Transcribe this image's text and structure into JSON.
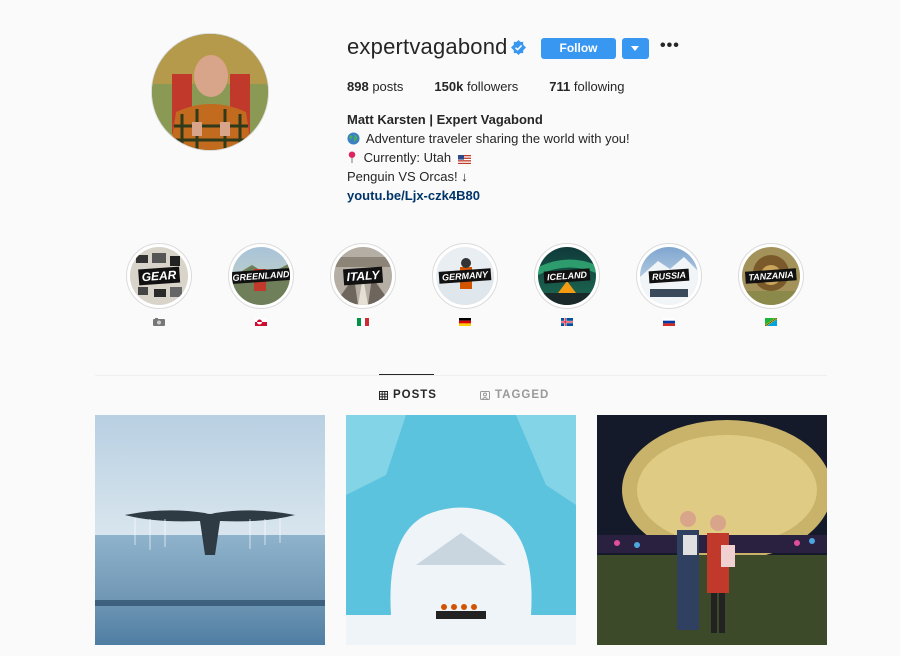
{
  "profile": {
    "username": "expertvagabond",
    "follow_label": "Follow",
    "more_label": "•••",
    "stats": {
      "posts_count": "898",
      "posts_label": "posts",
      "followers_count": "150k",
      "followers_label": "followers",
      "following_count": "711",
      "following_label": "following"
    },
    "bio": {
      "full_name": "Matt Karsten | Expert Vagabond",
      "line1": "Adventure traveler sharing the world with you!",
      "line2": "Currently: Utah",
      "line3": "Penguin VS Orcas! ↓",
      "link": "youtu.be/Ljx-czk4B80"
    }
  },
  "highlights": [
    {
      "label": "GEAR",
      "flag_icon": "camera-icon"
    },
    {
      "label": "GREENLAND",
      "flag_icon": "greenland-flag-icon"
    },
    {
      "label": "ITALY",
      "flag_icon": "italy-flag-icon"
    },
    {
      "label": "GERMANY",
      "flag_icon": "germany-flag-icon"
    },
    {
      "label": "ICELAND",
      "flag_icon": "iceland-flag-icon"
    },
    {
      "label": "RUSSIA",
      "flag_icon": "russia-flag-icon"
    },
    {
      "label": "TANZANIA",
      "flag_icon": "tanzania-flag-icon"
    }
  ],
  "tabs": {
    "posts": "POSTS",
    "tagged": "TAGGED"
  },
  "colors": {
    "accent": "#3897f0",
    "link": "#003569",
    "text": "#262626",
    "muted": "#999999"
  }
}
